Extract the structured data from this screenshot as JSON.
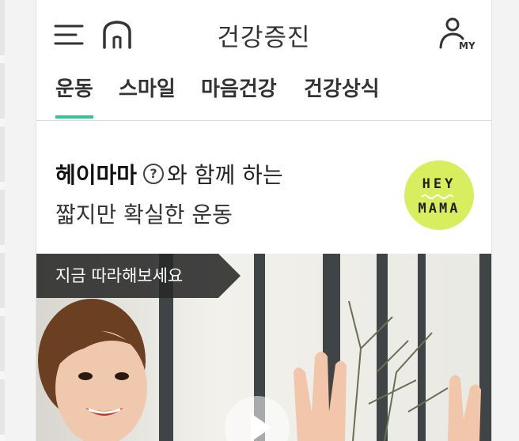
{
  "header": {
    "title": "건강증진",
    "my_label": "MY",
    "icons": [
      "menu-icon",
      "home-icon",
      "user-icon"
    ]
  },
  "tabs": [
    {
      "label": "운동",
      "active": true
    },
    {
      "label": "스마일",
      "active": false
    },
    {
      "label": "마음건강",
      "active": false
    },
    {
      "label": "건강상식",
      "active": false
    }
  ],
  "promo": {
    "brand": "헤이마마",
    "line1_rest": "와 함께 하는",
    "line2": "짧지만 확실한 운동",
    "badge_top": "HEY",
    "badge_bottom": "MAMA",
    "badge_color": "#d9ee5f"
  },
  "video": {
    "tag": "지금 따라해보세요"
  },
  "colors": {
    "accent": "#34c39a",
    "text": "#333333"
  }
}
